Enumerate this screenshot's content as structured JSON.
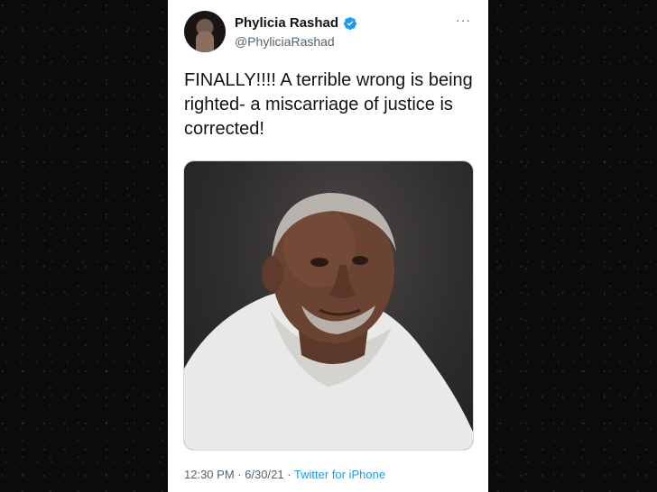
{
  "tweet": {
    "author_name": "Phylicia Rashad",
    "author_handle": "@PhyliciaRashad",
    "more_label": "···",
    "text": "FINALLY!!!! A terrible wrong is being righted- a miscarriage of justice is corrected!",
    "time": "12:30 PM",
    "sep1": " · ",
    "date": "6/30/21",
    "sep2": " · ",
    "source": "Twitter for iPhone",
    "verified": true,
    "accent_color": "#1d9bf0"
  }
}
